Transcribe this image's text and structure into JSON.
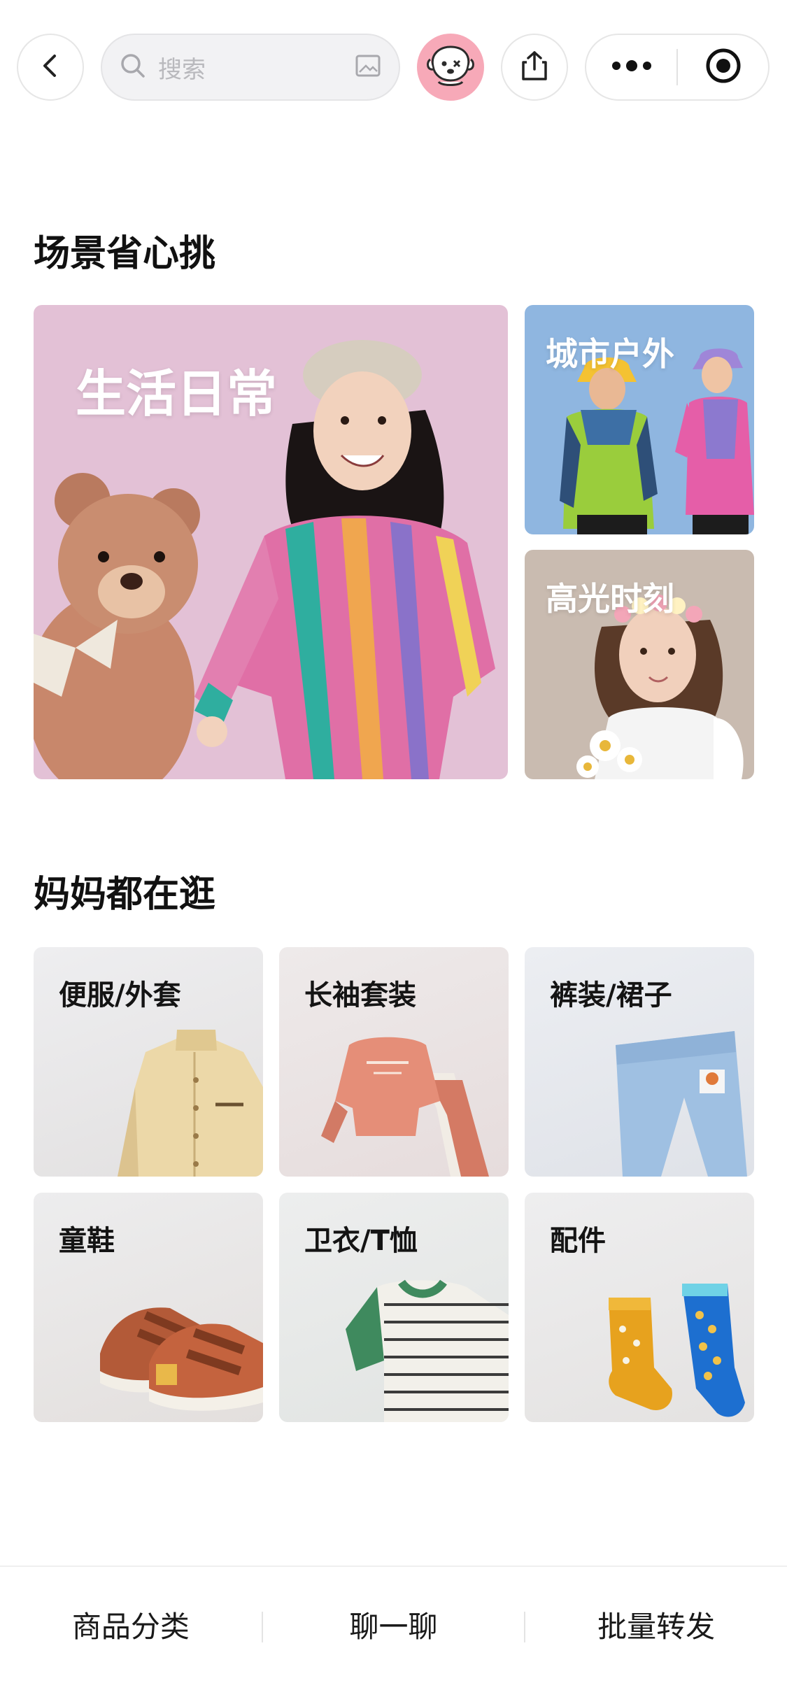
{
  "header": {
    "search_placeholder": "搜索",
    "icons": {
      "back": "chevron-left-icon",
      "search": "search-icon",
      "image_search": "image-icon",
      "avatar": "cartoon-dog-avatar",
      "share": "share-icon",
      "more": "more-dots-icon",
      "close": "target-circle-icon"
    }
  },
  "scene_section": {
    "title": "场景省心挑",
    "cards": [
      {
        "label": "生活日常"
      },
      {
        "label": "城市户外"
      },
      {
        "label": "高光时刻"
      }
    ]
  },
  "mom_section": {
    "title": "妈妈都在逛",
    "categories": [
      {
        "label": "便服/外套"
      },
      {
        "label": "长袖套装"
      },
      {
        "label": "裤装/裙子"
      },
      {
        "label": "童鞋"
      },
      {
        "label": "卫衣/T恤"
      },
      {
        "label": "配件"
      }
    ]
  },
  "bottom_bar": {
    "tabs": [
      {
        "label": "商品分类"
      },
      {
        "label": "聊一聊"
      },
      {
        "label": "批量转发"
      }
    ]
  },
  "colors": {
    "big_card_bg": "#e3c1d6",
    "outdoor_card_bg": "#8fb6e0",
    "highlight_card_bg": "#c9bbb0",
    "avatar_bg": "#f7a9b8"
  }
}
